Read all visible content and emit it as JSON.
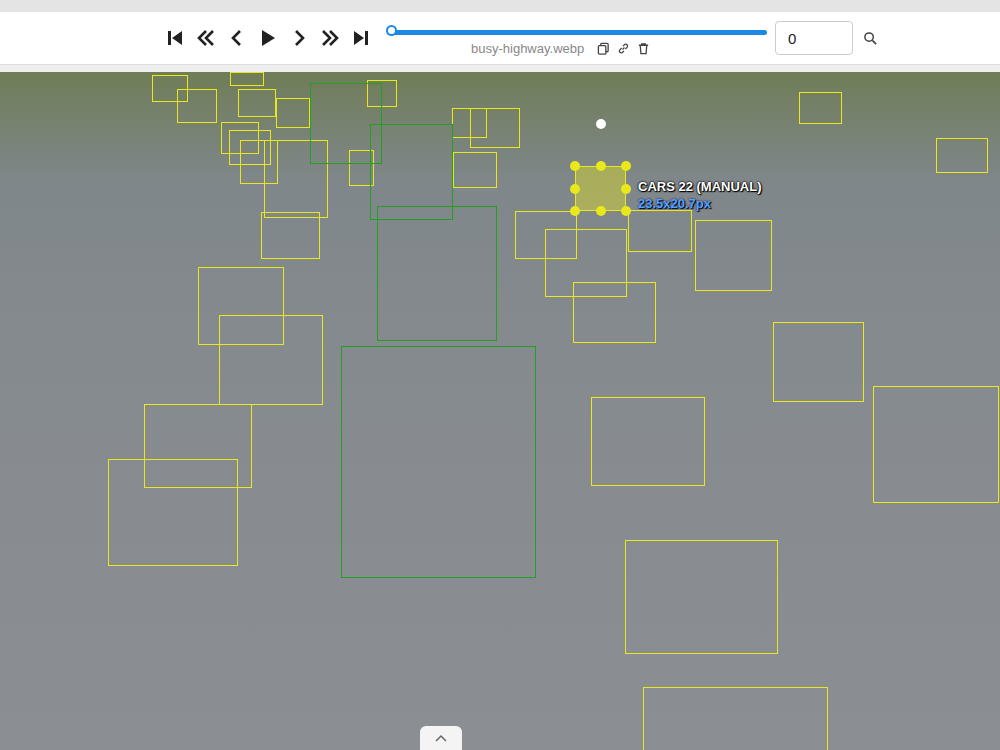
{
  "toolbar": {
    "filename": "busy-highway.webp",
    "timeline": {
      "level": 0
    },
    "frame": {
      "value": "0"
    }
  },
  "annotations": [
    {
      "color": "#e8e81a",
      "selected": false
    },
    {
      "color": "#e8e81a",
      "selected": false
    },
    {
      "color": "#e8e81a",
      "selected": false
    },
    {
      "color": "#e8e81a",
      "selected": false
    },
    {
      "color": "#e8e81a",
      "selected": false
    },
    {
      "color": "#e8e81a",
      "selected": false
    },
    {
      "color": "#e8e81a",
      "selected": false
    },
    {
      "color": "#e8e81a",
      "selected": false
    },
    {
      "color": "#e8e81a",
      "selected": false
    },
    {
      "color": "#e8e81a",
      "selected": false
    },
    {
      "color": "#e8e81a",
      "selected": false
    },
    {
      "color": "#e8e81a",
      "selected": false
    },
    {
      "color": "#e8e81a",
      "selected": false
    },
    {
      "color": "#e8e81a",
      "selected": false
    },
    {
      "color": "#e8e81a",
      "selected": false
    },
    {
      "color": "#e8e81a",
      "selected": false
    },
    {
      "color": "#e8e81a",
      "selected": false
    },
    {
      "color": "#e8e81a",
      "selected": false
    },
    {
      "color": "#e8e81a",
      "selected": false
    },
    {
      "color": "#e8e81a",
      "selected": false
    },
    {
      "color": "#e8e81a",
      "selected": false
    },
    {
      "color": "#e8e81a",
      "selected": false
    },
    {
      "color": "#e8e81a",
      "selected": false
    },
    {
      "color": "#e8e81a",
      "selected": false
    },
    {
      "color": "#e8e81a",
      "selected": false
    },
    {
      "color": "#e8e81a",
      "selected": false
    },
    {
      "color": "#e8e81a",
      "selected": false
    },
    {
      "color": "#e8e81a",
      "selected": false
    },
    {
      "color": "#e8e81a",
      "selected": false
    },
    {
      "color": "#e8e81a",
      "selected": false
    },
    {
      "color": "#e8e81a",
      "selected": false
    },
    {
      "color": "#22a022",
      "selected": false
    },
    {
      "color": "#22a022",
      "selected": false
    },
    {
      "color": "#22a022",
      "selected": false
    },
    {
      "color": "#22a022",
      "selected": false
    },
    {
      "color": "#e8e81a",
      "selected": true
    }
  ],
  "selected_label": {
    "label": "CARS 22 (MANUAL)",
    "size": "23.5x20.7px"
  }
}
